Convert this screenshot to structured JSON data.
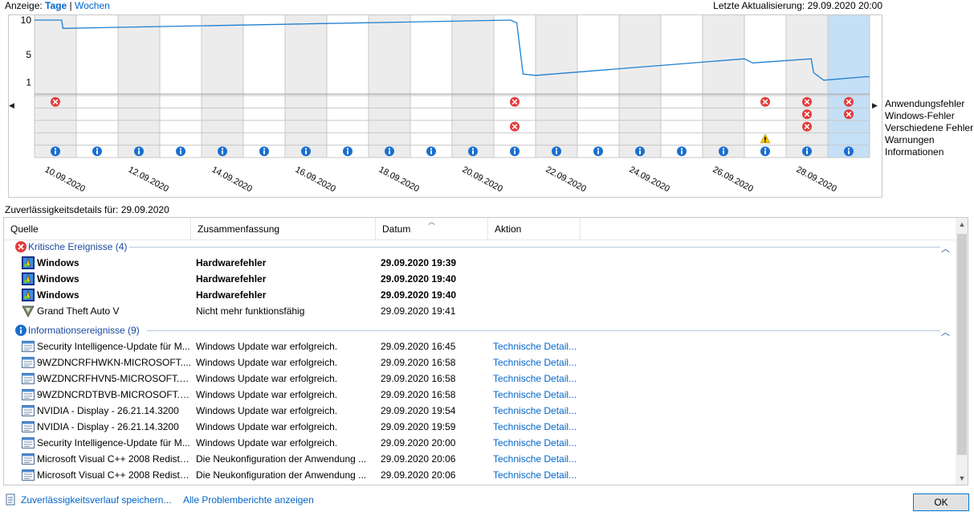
{
  "toolbar": {
    "view_label": "Anzeige:",
    "view_days": "Tage",
    "separator": "|",
    "view_weeks": "Wochen"
  },
  "last_update": "Letzte Aktualisierung: 29.09.2020 20:00",
  "chart_data": {
    "type": "line",
    "y_ticks": [
      "10",
      "5",
      "1"
    ],
    "ylim": [
      0,
      10
    ],
    "date_labels": [
      "10.09.2020",
      "12.09.2020",
      "14.09.2020",
      "16.09.2020",
      "18.09.2020",
      "20.09.2020",
      "22.09.2020",
      "24.09.2020",
      "26.09.2020",
      "28.09.2020"
    ],
    "days": 20,
    "selected_day_index": 19,
    "stability_index": [
      [
        0,
        10
      ],
      [
        0.65,
        10
      ],
      [
        0.68,
        8.8
      ],
      [
        11.4,
        10
      ],
      [
        11.55,
        9.6
      ],
      [
        11.7,
        2.2
      ],
      [
        12.0,
        2.0
      ],
      [
        17.0,
        4.4
      ],
      [
        17.2,
        3.8
      ],
      [
        18.6,
        4.4
      ],
      [
        18.66,
        2.4
      ],
      [
        18.9,
        1.3
      ],
      [
        19.9,
        1.8
      ],
      [
        20,
        1.8
      ]
    ],
    "event_rows": [
      "Anwendungsfehler",
      "Windows-Fehler",
      "Verschiedene Fehler",
      "Warnungen",
      "Informationen"
    ],
    "events": {
      "Anwendungsfehler": [
        0,
        11,
        17,
        18,
        19
      ],
      "Windows-Fehler": [
        18,
        19
      ],
      "Verschiedene Fehler": [
        11,
        18
      ],
      "Warnungen": [
        17
      ],
      "Informationen": [
        0,
        1,
        2,
        3,
        4,
        5,
        6,
        7,
        8,
        9,
        10,
        11,
        12,
        13,
        14,
        15,
        16,
        17,
        18,
        19
      ]
    }
  },
  "legend": {
    "app_errors": "Anwendungsfehler",
    "win_errors": "Windows-Fehler",
    "misc_errors": "Verschiedene Fehler",
    "warnings": "Warnungen",
    "info": "Informationen"
  },
  "details_title": "Zuverlässigkeitsdetails für: 29.09.2020",
  "table": {
    "columns": [
      "Quelle",
      "Zusammenfassung",
      "Datum",
      "Aktion"
    ],
    "critical_group": "Kritische Ereignisse (4)",
    "info_group": "Informationsereignisse (9)",
    "critical_rows": [
      {
        "source": "Windows",
        "summary": "Hardwarefehler",
        "date": "29.09.2020 19:39",
        "action": "",
        "icon": "windows-shield-icon",
        "bold": true
      },
      {
        "source": "Windows",
        "summary": "Hardwarefehler",
        "date": "29.09.2020 19:40",
        "action": "",
        "icon": "windows-shield-icon",
        "bold": true
      },
      {
        "source": "Windows",
        "summary": "Hardwarefehler",
        "date": "29.09.2020 19:40",
        "action": "",
        "icon": "windows-shield-icon",
        "bold": true
      },
      {
        "source": "Grand Theft Auto V",
        "summary": "Nicht mehr funktionsfähig",
        "date": "29.09.2020 19:41",
        "action": "",
        "icon": "gta-icon",
        "bold": false
      }
    ],
    "info_rows": [
      {
        "source": "Security Intelligence-Update für M...",
        "summary": "Windows Update war erfolgreich.",
        "date": "29.09.2020 16:45",
        "action": "Technische Detail..."
      },
      {
        "source": "9WZDNCRFHWKN-MICROSOFT....",
        "summary": "Windows Update war erfolgreich.",
        "date": "29.09.2020 16:58",
        "action": "Technische Detail..."
      },
      {
        "source": "9WZDNCRFHVN5-MICROSOFT.WI...",
        "summary": "Windows Update war erfolgreich.",
        "date": "29.09.2020 16:58",
        "action": "Technische Detail..."
      },
      {
        "source": "9WZDNCRDTBVB-MICROSOFT.WI...",
        "summary": "Windows Update war erfolgreich.",
        "date": "29.09.2020 16:58",
        "action": "Technische Detail..."
      },
      {
        "source": "NVIDIA - Display - 26.21.14.3200",
        "summary": "Windows Update war erfolgreich.",
        "date": "29.09.2020 19:54",
        "action": "Technische Detail..."
      },
      {
        "source": "NVIDIA - Display - 26.21.14.3200",
        "summary": "Windows Update war erfolgreich.",
        "date": "29.09.2020 19:59",
        "action": "Technische Detail..."
      },
      {
        "source": "Security Intelligence-Update für M...",
        "summary": "Windows Update war erfolgreich.",
        "date": "29.09.2020 20:00",
        "action": "Technische Detail..."
      },
      {
        "source": "Microsoft Visual C++ 2008 Redistri...",
        "summary": "Die Neukonfiguration der Anwendung ...",
        "date": "29.09.2020 20:06",
        "action": "Technische Detail..."
      },
      {
        "source": "Microsoft Visual C++ 2008 Redistri...",
        "summary": "Die Neukonfiguration der Anwendung ...",
        "date": "29.09.2020 20:06",
        "action": "Technische Detail..."
      }
    ]
  },
  "footer": {
    "save_history": "Zuverlässigkeitsverlauf speichern...",
    "all_reports": "Alle Problemberichte anzeigen",
    "ok": "OK"
  },
  "colors": {
    "accent": "#0066cc",
    "line": "#1f7fd1",
    "selected": "#c5dff7",
    "error": "#e23b3b",
    "warning": "#f4c400",
    "info": "#1a6fd0"
  }
}
